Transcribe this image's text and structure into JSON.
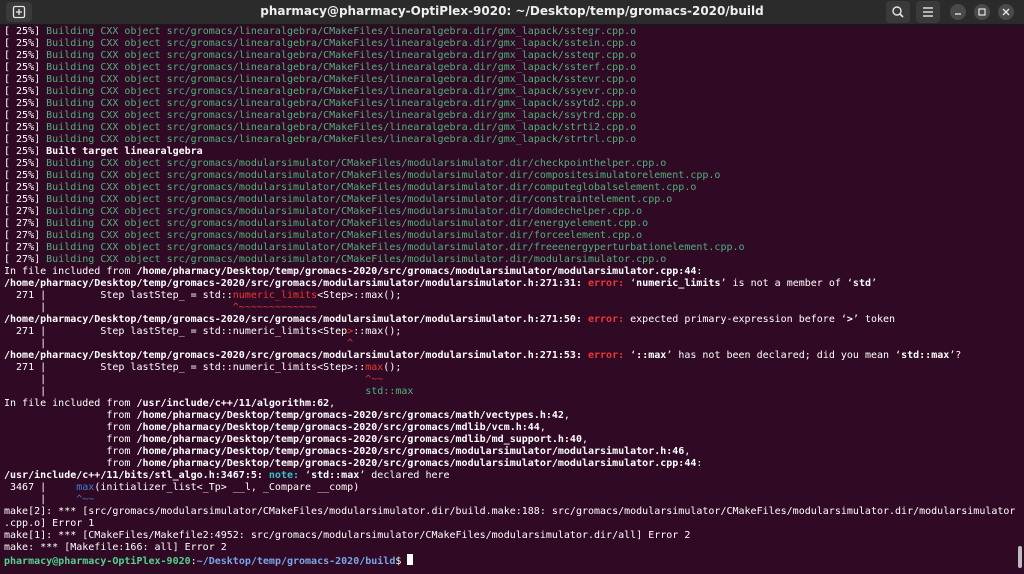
{
  "window": {
    "title": "pharmacy@pharmacy-OptiPlex-9020: ~/Desktop/temp/gromacs-2020/build"
  },
  "icons": {
    "new_tab": "new-tab-icon",
    "search": "search-icon",
    "menu": "hamburger-menu-icon",
    "minimize": "minimize-icon",
    "maximize": "maximize-icon",
    "close": "close-icon"
  },
  "colors": {
    "background": "#300a24",
    "titlebar": "#2b2b2b",
    "green": "#4fb07a",
    "error": "#ef3535",
    "note": "#34c3c8",
    "prompt_user": "#52d28a",
    "prompt_path": "#7aa6e8"
  },
  "lines": [
    [
      {
        "t": "[ 25%] ",
        "c": "white"
      },
      {
        "t": "Building CXX object src/gromacs/linearalgebra/CMakeFiles/linearalgebra.dir/gmx_lapack/sstegr.cpp.o",
        "c": "green"
      }
    ],
    [
      {
        "t": "[ 25%] ",
        "c": "white"
      },
      {
        "t": "Building CXX object src/gromacs/linearalgebra/CMakeFiles/linearalgebra.dir/gmx_lapack/sstein.cpp.o",
        "c": "green"
      }
    ],
    [
      {
        "t": "[ 25%] ",
        "c": "white"
      },
      {
        "t": "Building CXX object src/gromacs/linearalgebra/CMakeFiles/linearalgebra.dir/gmx_lapack/ssteqr.cpp.o",
        "c": "green"
      }
    ],
    [
      {
        "t": "[ 25%] ",
        "c": "white"
      },
      {
        "t": "Building CXX object src/gromacs/linearalgebra/CMakeFiles/linearalgebra.dir/gmx_lapack/ssterf.cpp.o",
        "c": "green"
      }
    ],
    [
      {
        "t": "[ 25%] ",
        "c": "white"
      },
      {
        "t": "Building CXX object src/gromacs/linearalgebra/CMakeFiles/linearalgebra.dir/gmx_lapack/sstevr.cpp.o",
        "c": "green"
      }
    ],
    [
      {
        "t": "[ 25%] ",
        "c": "white"
      },
      {
        "t": "Building CXX object src/gromacs/linearalgebra/CMakeFiles/linearalgebra.dir/gmx_lapack/ssyevr.cpp.o",
        "c": "green"
      }
    ],
    [
      {
        "t": "[ 25%] ",
        "c": "white"
      },
      {
        "t": "Building CXX object src/gromacs/linearalgebra/CMakeFiles/linearalgebra.dir/gmx_lapack/ssytd2.cpp.o",
        "c": "green"
      }
    ],
    [
      {
        "t": "[ 25%] ",
        "c": "white"
      },
      {
        "t": "Building CXX object src/gromacs/linearalgebra/CMakeFiles/linearalgebra.dir/gmx_lapack/ssytrd.cpp.o",
        "c": "green"
      }
    ],
    [
      {
        "t": "[ 25%] ",
        "c": "white"
      },
      {
        "t": "Building CXX object src/gromacs/linearalgebra/CMakeFiles/linearalgebra.dir/gmx_lapack/strti2.cpp.o",
        "c": "green"
      }
    ],
    [
      {
        "t": "[ 25%] ",
        "c": "white"
      },
      {
        "t": "Building CXX object src/gromacs/linearalgebra/CMakeFiles/linearalgebra.dir/gmx_lapack/strtrl.cpp.o",
        "c": "green"
      }
    ],
    [
      {
        "t": "[ 25%] ",
        "c": "white"
      },
      {
        "t": "Built target linearalgebra",
        "c": "bold"
      }
    ],
    [
      {
        "t": "[ 25%] ",
        "c": "white"
      },
      {
        "t": "Building CXX object src/gromacs/modularsimulator/CMakeFiles/modularsimulator.dir/checkpointhelper.cpp.o",
        "c": "green"
      }
    ],
    [
      {
        "t": "[ 25%] ",
        "c": "white"
      },
      {
        "t": "Building CXX object src/gromacs/modularsimulator/CMakeFiles/modularsimulator.dir/compositesimulatorelement.cpp.o",
        "c": "green"
      }
    ],
    [
      {
        "t": "[ 25%] ",
        "c": "white"
      },
      {
        "t": "Building CXX object src/gromacs/modularsimulator/CMakeFiles/modularsimulator.dir/computeglobalselement.cpp.o",
        "c": "green"
      }
    ],
    [
      {
        "t": "[ 25%] ",
        "c": "white"
      },
      {
        "t": "Building CXX object src/gromacs/modularsimulator/CMakeFiles/modularsimulator.dir/constraintelement.cpp.o",
        "c": "green"
      }
    ],
    [
      {
        "t": "[ 27%] ",
        "c": "white"
      },
      {
        "t": "Building CXX object src/gromacs/modularsimulator/CMakeFiles/modularsimulator.dir/domdechelper.cpp.o",
        "c": "green"
      }
    ],
    [
      {
        "t": "[ 27%] ",
        "c": "white"
      },
      {
        "t": "Building CXX object src/gromacs/modularsimulator/CMakeFiles/modularsimulator.dir/energyelement.cpp.o",
        "c": "green"
      }
    ],
    [
      {
        "t": "[ 27%] ",
        "c": "white"
      },
      {
        "t": "Building CXX object src/gromacs/modularsimulator/CMakeFiles/modularsimulator.dir/forceelement.cpp.o",
        "c": "green"
      }
    ],
    [
      {
        "t": "[ 27%] ",
        "c": "white"
      },
      {
        "t": "Building CXX object src/gromacs/modularsimulator/CMakeFiles/modularsimulator.dir/freeenergyperturbationelement.cpp.o",
        "c": "green"
      }
    ],
    [
      {
        "t": "[ 27%] ",
        "c": "white"
      },
      {
        "t": "Building CXX object src/gromacs/modularsimulator/CMakeFiles/modularsimulator.dir/modularsimulator.cpp.o",
        "c": "green"
      }
    ],
    [
      {
        "t": "In file included from ",
        "c": "white"
      },
      {
        "t": "/home/pharmacy/Desktop/temp/gromacs-2020/src/gromacs/modularsimulator/modularsimulator.cpp:44",
        "c": "bold"
      },
      {
        "t": ":",
        "c": "white"
      }
    ],
    [
      {
        "t": "/home/pharmacy/Desktop/temp/gromacs-2020/src/gromacs/modularsimulator/modularsimulator.h:271:31:",
        "c": "bold"
      },
      {
        "t": " error: ",
        "c": "red"
      },
      {
        "t": "‘",
        "c": "white"
      },
      {
        "t": "numeric_limits",
        "c": "bold"
      },
      {
        "t": "’ is not a member of ‘",
        "c": "white"
      },
      {
        "t": "std",
        "c": "bold"
      },
      {
        "t": "’",
        "c": "white"
      }
    ],
    [
      {
        "t": "  271 |         Step lastStep_ = std::",
        "c": "white"
      },
      {
        "t": "numeric_limits",
        "c": "redn"
      },
      {
        "t": "<Step>::max();",
        "c": "white"
      }
    ],
    [
      {
        "t": "      |                               ",
        "c": "white"
      },
      {
        "t": "^~~~~~~~~~~~~~",
        "c": "redn"
      }
    ],
    [
      {
        "t": "/home/pharmacy/Desktop/temp/gromacs-2020/src/gromacs/modularsimulator/modularsimulator.h:271:50:",
        "c": "bold"
      },
      {
        "t": " error: ",
        "c": "red"
      },
      {
        "t": "expected primary-expression before ‘",
        "c": "white"
      },
      {
        "t": ">",
        "c": "bold"
      },
      {
        "t": "’ token",
        "c": "white"
      }
    ],
    [
      {
        "t": "  271 |         Step lastStep_ = std::numeric_limits<Step",
        "c": "white"
      },
      {
        "t": ">",
        "c": "redn"
      },
      {
        "t": "::max();",
        "c": "white"
      }
    ],
    [
      {
        "t": "      |                                                  ",
        "c": "white"
      },
      {
        "t": "^",
        "c": "redn"
      }
    ],
    [
      {
        "t": "/home/pharmacy/Desktop/temp/gromacs-2020/src/gromacs/modularsimulator/modularsimulator.h:271:53:",
        "c": "bold"
      },
      {
        "t": " error: ",
        "c": "red"
      },
      {
        "t": "‘",
        "c": "white"
      },
      {
        "t": "::max",
        "c": "bold"
      },
      {
        "t": "’ has not been declared; did you mean ‘",
        "c": "white"
      },
      {
        "t": "std::max",
        "c": "bold"
      },
      {
        "t": "’?",
        "c": "white"
      }
    ],
    [
      {
        "t": "  271 |         Step lastStep_ = std::numeric_limits<Step>::",
        "c": "white"
      },
      {
        "t": "max",
        "c": "redn"
      },
      {
        "t": "();",
        "c": "white"
      }
    ],
    [
      {
        "t": "      |                                                     ",
        "c": "white"
      },
      {
        "t": "^~~",
        "c": "redn"
      }
    ],
    [
      {
        "t": "      |                                                     ",
        "c": "white"
      },
      {
        "t": "std::max",
        "c": "greenn"
      }
    ],
    [
      {
        "t": "In file included from ",
        "c": "white"
      },
      {
        "t": "/usr/include/c++/11/algorithm:62",
        "c": "bold"
      },
      {
        "t": ",",
        "c": "white"
      }
    ],
    [
      {
        "t": "                 from ",
        "c": "white"
      },
      {
        "t": "/home/pharmacy/Desktop/temp/gromacs-2020/src/gromacs/math/vectypes.h:42",
        "c": "bold"
      },
      {
        "t": ",",
        "c": "white"
      }
    ],
    [
      {
        "t": "                 from ",
        "c": "white"
      },
      {
        "t": "/home/pharmacy/Desktop/temp/gromacs-2020/src/gromacs/mdlib/vcm.h:44",
        "c": "bold"
      },
      {
        "t": ",",
        "c": "white"
      }
    ],
    [
      {
        "t": "                 from ",
        "c": "white"
      },
      {
        "t": "/home/pharmacy/Desktop/temp/gromacs-2020/src/gromacs/mdlib/md_support.h:40",
        "c": "bold"
      },
      {
        "t": ",",
        "c": "white"
      }
    ],
    [
      {
        "t": "                 from ",
        "c": "white"
      },
      {
        "t": "/home/pharmacy/Desktop/temp/gromacs-2020/src/gromacs/modularsimulator/modularsimulator.h:46",
        "c": "bold"
      },
      {
        "t": ",",
        "c": "white"
      }
    ],
    [
      {
        "t": "                 from ",
        "c": "white"
      },
      {
        "t": "/home/pharmacy/Desktop/temp/gromacs-2020/src/gromacs/modularsimulator/modularsimulator.cpp:44",
        "c": "bold"
      },
      {
        "t": ":",
        "c": "white"
      }
    ],
    [
      {
        "t": "/usr/include/c++/11/bits/stl_algo.h:3467:5:",
        "c": "bold"
      },
      {
        "t": " note: ",
        "c": "cyan"
      },
      {
        "t": "‘",
        "c": "white"
      },
      {
        "t": "std::max",
        "c": "bold"
      },
      {
        "t": "’ declared here",
        "c": "white"
      }
    ],
    [
      {
        "t": " 3467 |     ",
        "c": "white"
      },
      {
        "t": "max",
        "c": "blue"
      },
      {
        "t": "(initializer_list<_Tp> __l, _Compare __comp)",
        "c": "white"
      }
    ],
    [
      {
        "t": "      |     ",
        "c": "white"
      },
      {
        "t": "^~~",
        "c": "blue"
      }
    ],
    [
      {
        "t": "make[2]: *** [src/gromacs/modularsimulator/CMakeFiles/modularsimulator.dir/build.make:188: src/gromacs/modularsimulator/CMakeFiles/modularsimulator.dir/modularsimulator",
        "c": "white"
      }
    ],
    [
      {
        "t": ".cpp.o] Error 1",
        "c": "white"
      }
    ],
    [
      {
        "t": "make[1]: *** [CMakeFiles/Makefile2:4952: src/gromacs/modularsimulator/CMakeFiles/modularsimulator.dir/all] Error 2",
        "c": "white"
      }
    ],
    [
      {
        "t": "make: *** [Makefile:166: all] Error 2",
        "c": "white"
      }
    ]
  ],
  "prompt": {
    "user_host": "pharmacy@pharmacy-OptiPlex-9020",
    "separator": ":",
    "path": "~/Desktop/temp/gromacs-2020/build",
    "symbol": "$ "
  }
}
